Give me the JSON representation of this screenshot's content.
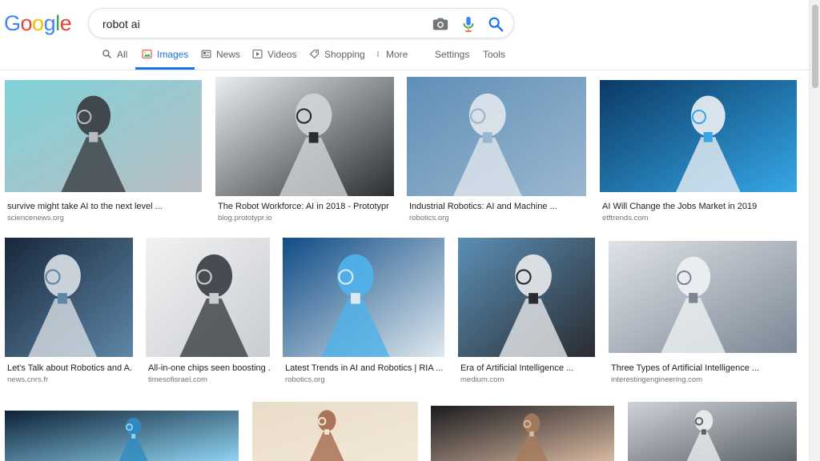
{
  "logo": {
    "letters": [
      "G",
      "o",
      "o",
      "g",
      "l",
      "e"
    ],
    "colors": [
      "#4285f4",
      "#ea4335",
      "#fbbc05",
      "#4285f4",
      "#34a853",
      "#ea4335"
    ]
  },
  "search": {
    "query": "robot ai",
    "placeholder": ""
  },
  "tabs": [
    {
      "label": "All",
      "icon": "search-icon"
    },
    {
      "label": "Images",
      "icon": "image-icon",
      "active": true
    },
    {
      "label": "News",
      "icon": "news-icon"
    },
    {
      "label": "Videos",
      "icon": "video-icon"
    },
    {
      "label": "Shopping",
      "icon": "tag-icon"
    },
    {
      "label": "More",
      "icon": "more-vert-icon"
    },
    {
      "label": "Settings"
    },
    {
      "label": "Tools"
    }
  ],
  "results": [
    {
      "title": "survive might take AI to the next level ...",
      "source": "sciencenews.org",
      "palette": [
        "#7fd3d8",
        "#3a3d42",
        "#b8bcc2"
      ]
    },
    {
      "title": "The Robot Workforce: AI in 2018 - Prototypr",
      "source": "blog.prototypr.io",
      "palette": [
        "#e9eef0",
        "#cfd4d8",
        "#2a2d32"
      ]
    },
    {
      "title": "Industrial Robotics: AI and Machine ...",
      "source": "robotics.org",
      "palette": [
        "#5f8fb7",
        "#dfe6ec",
        "#9bb7cf"
      ]
    },
    {
      "title": "AI Will Change the Jobs Market in 2019",
      "source": "etftrends.com",
      "palette": [
        "#0b3a66",
        "#e9eef3",
        "#35a7e6"
      ]
    },
    {
      "title": "Let's Talk about Robotics and A...",
      "source": "news.cnrs.fr",
      "palette": [
        "#18273a",
        "#d7dde3",
        "#5e86a8"
      ]
    },
    {
      "title": "All-in-one chips seen boosting ...",
      "source": "timesofisrael.com",
      "palette": [
        "#f1f2f3",
        "#3b3e44",
        "#c9ccd0"
      ]
    },
    {
      "title": "Latest Trends in AI and Robotics | RIA ...",
      "source": "robotics.org",
      "palette": [
        "#0f4c86",
        "#4fb2ea",
        "#dfe8ee"
      ]
    },
    {
      "title": "Era of Artificial Intelligence ...",
      "source": "medium.com",
      "palette": [
        "#5b8fb6",
        "#e6e8ea",
        "#2a2c31"
      ]
    },
    {
      "title": "Three Types of Artificial Intelligence ...",
      "source": "interestingengineering.com",
      "palette": [
        "#dfe3e8",
        "#eef1f3",
        "#7b8794"
      ]
    },
    {
      "title": "",
      "source": "",
      "palette": [
        "#0d2236",
        "#2f8bc2",
        "#8fd3f2"
      ]
    },
    {
      "title": "",
      "source": "",
      "palette": [
        "#e9dcc9",
        "#a46b4c",
        "#f3e7d6"
      ]
    },
    {
      "title": "",
      "source": "",
      "palette": [
        "#1b1b1f",
        "#a67b5b",
        "#d8b8a0"
      ]
    },
    {
      "title": "",
      "source": "",
      "palette": [
        "#cfd3d8",
        "#ecefef",
        "#5b6169"
      ]
    }
  ]
}
